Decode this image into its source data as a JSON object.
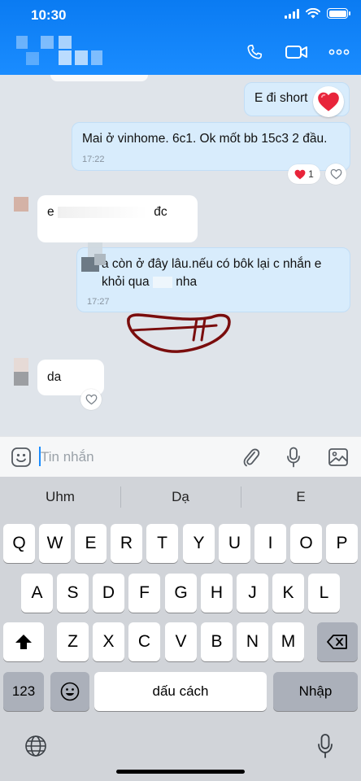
{
  "status_bar": {
    "time": "10:30"
  },
  "header": {
    "icons": [
      "phone-icon",
      "video-icon",
      "more-icon"
    ]
  },
  "messages": {
    "m1": {
      "text": "E đi short",
      "reaction": "heart"
    },
    "m2": {
      "text": "Mai ở vinhome. 6c1. Ok mốt bb 15c3 2 đầu.",
      "time": "17:22",
      "reaction_count": "1"
    },
    "m3": {
      "text_start": "e",
      "text_end": "đc"
    },
    "m4": {
      "line1": "a còn ở đây lâu.nếu có bôk lại c nhắn e",
      "line2_a": "khỏi qua",
      "line2_b": "nha",
      "time": "17:27"
    },
    "m5": {
      "text": "da"
    }
  },
  "input": {
    "placeholder": "Tin nhắn"
  },
  "keyboard": {
    "suggestions": [
      "Uhm",
      "Dạ",
      "E"
    ],
    "row1": [
      "Q",
      "W",
      "E",
      "R",
      "T",
      "Y",
      "U",
      "I",
      "O",
      "P"
    ],
    "row2": [
      "A",
      "S",
      "D",
      "F",
      "G",
      "H",
      "J",
      "K",
      "L"
    ],
    "row3": [
      "Z",
      "X",
      "C",
      "V",
      "B",
      "N",
      "M"
    ],
    "numbers_label": "123",
    "space_label": "dấu cách",
    "return_label": "Nhập"
  },
  "colors": {
    "header": "#1a8cff",
    "my_bubble": "#d8ecfc",
    "chat_bg": "#dfe4ea",
    "heart": "#e8243a"
  }
}
